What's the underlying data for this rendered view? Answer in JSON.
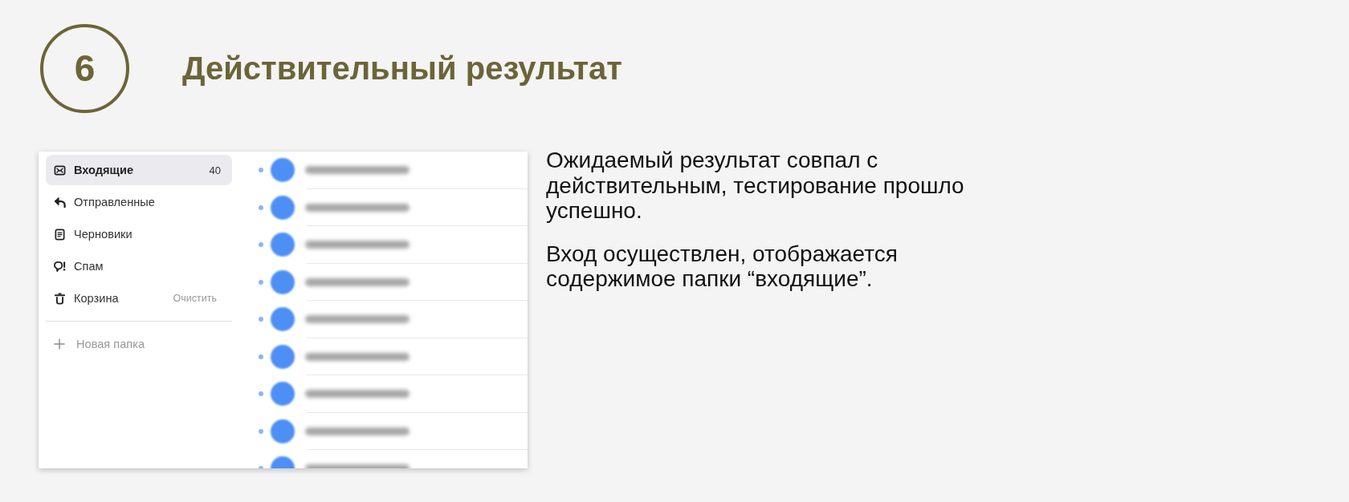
{
  "step": {
    "number": "6",
    "title": "Действительный результат"
  },
  "mail": {
    "folders": [
      {
        "kind": "inbox",
        "label": "Входящие",
        "count": "40",
        "selected": true
      },
      {
        "kind": "sent",
        "label": "Отправленные",
        "selected": false
      },
      {
        "kind": "drafts",
        "label": "Черновики",
        "selected": false
      },
      {
        "kind": "spam",
        "label": "Спам",
        "selected": false
      },
      {
        "kind": "trash",
        "label": "Корзина",
        "action": "Очистить",
        "selected": false
      }
    ],
    "new_folder": "Новая папка",
    "messages": [
      {
        "unread": true
      },
      {
        "unread": true
      },
      {
        "unread": true
      },
      {
        "unread": true
      },
      {
        "unread": true
      },
      {
        "unread": true
      },
      {
        "unread": true
      },
      {
        "unread": true
      },
      {
        "unread": true
      }
    ]
  },
  "description": [
    "Ожидаемый результат совпал с действительным, тестирование прошло успешно.",
    "Вход осуществлен, отображается содержимое папки “входящие”."
  ]
}
